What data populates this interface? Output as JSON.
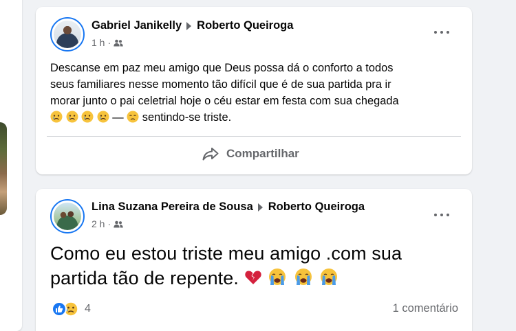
{
  "posts": [
    {
      "author": "Gabriel Janikelly",
      "target": "Roberto Queiroga",
      "time": "1 h",
      "text_lines": [
        "Descanse em paz meu amigo que Deus possa dá o conforto a todos",
        "seus familiares nesse momento tão difícil que é de sua partida pra ir",
        "morar junto o pai celetrial hoje o céu estar em festa com sua chegada"
      ],
      "feeling_dash": "—",
      "feeling_text": "sentindo-se triste.",
      "share_label": "Compartilhar"
    },
    {
      "author": "Lina Suzana Pereira de Sousa",
      "target": "Roberto Queiroga",
      "time": "2 h",
      "text_line1": "Como eu estou triste meu amigo .com sua",
      "text_line2": "partida tão de repente.",
      "reaction_count": "4",
      "comments_label": "1 comentário"
    }
  ],
  "icons": {
    "more": "more-horizontal-icon",
    "audience": "friends-icon",
    "share": "share-arrow-icon",
    "like": "like-reaction-icon",
    "sad": "sad-reaction-icon"
  },
  "colors": {
    "accent": "#1877f2",
    "secondary_text": "#65676b",
    "background": "#f0f2f5"
  }
}
